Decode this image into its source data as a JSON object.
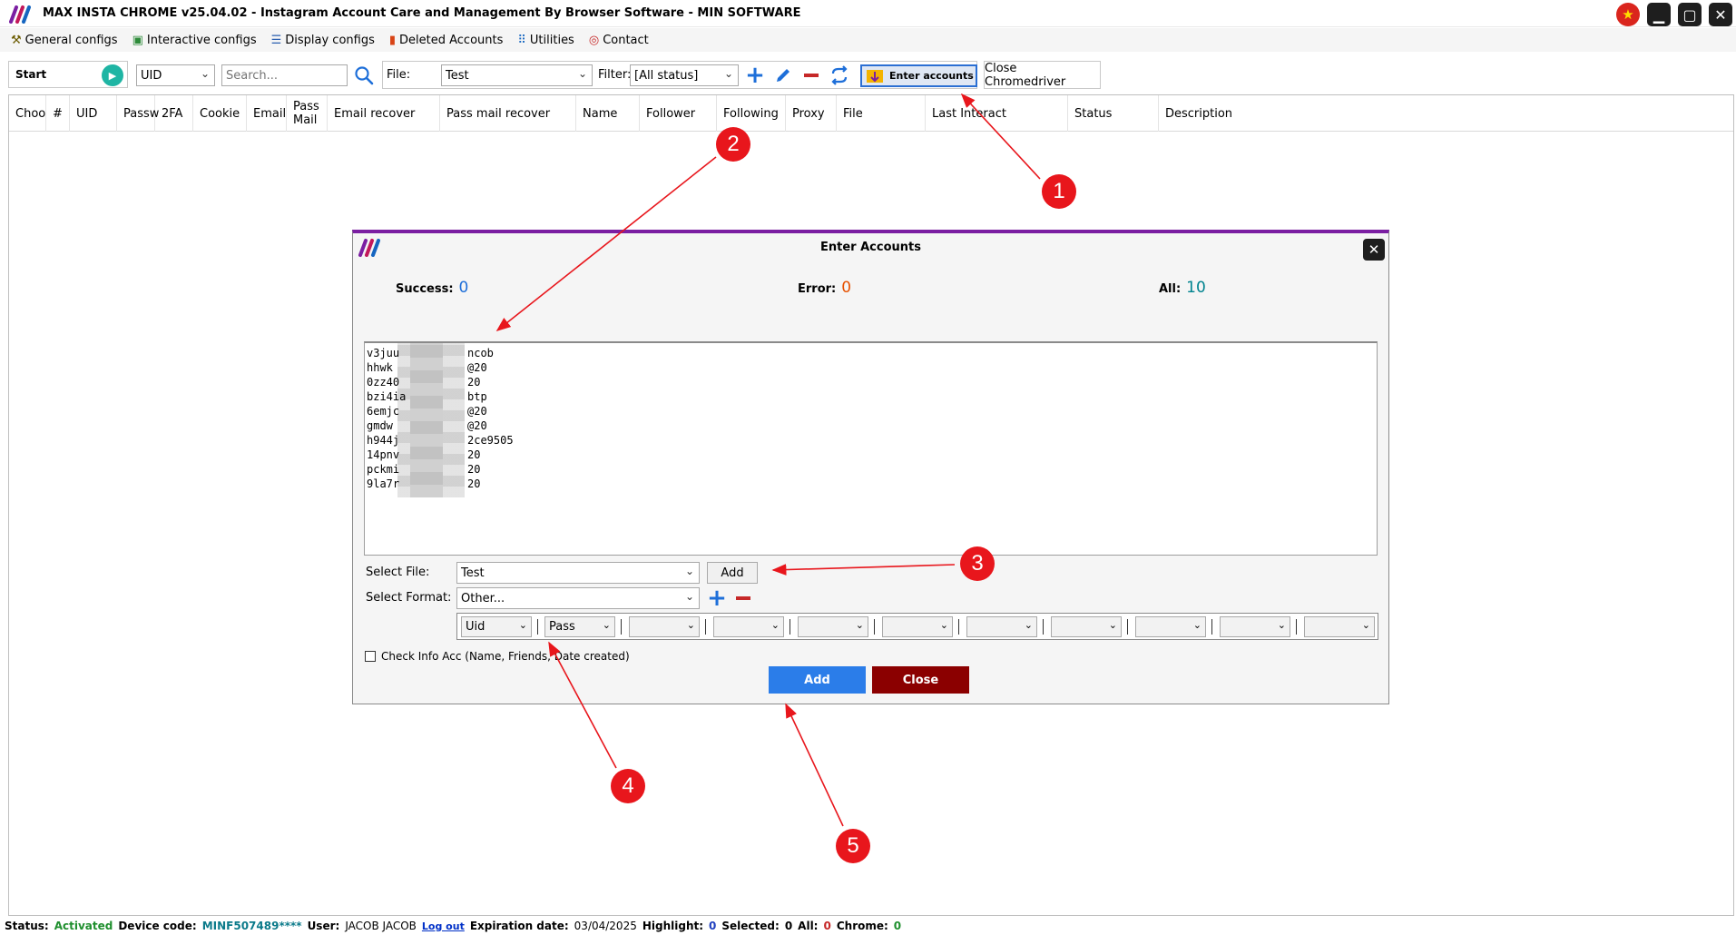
{
  "window": {
    "title": "MAX INSTA CHROME v25.04.02 - Instagram Account Care and Management By Browser Software - MIN SOFTWARE"
  },
  "menu": [
    {
      "label": "General configs",
      "icon": "wrench-icon"
    },
    {
      "label": "Interactive configs",
      "icon": "interactive-icon"
    },
    {
      "label": "Display configs",
      "icon": "list-icon"
    },
    {
      "label": "Deleted Accounts",
      "icon": "trash-icon"
    },
    {
      "label": "Utilities",
      "icon": "grid-icon"
    },
    {
      "label": "Contact",
      "icon": "lifebuoy-icon"
    }
  ],
  "toolbar": {
    "start_label": "Start",
    "search_by": "UID",
    "search_placeholder": "Search...",
    "file_label": "File:",
    "file_value": "Test",
    "filter_label": "Filter:",
    "filter_value": "[All status]",
    "enter_accounts_label": "Enter accounts",
    "close_chromedriver_label": "Close Chromedriver"
  },
  "grid": {
    "columns": [
      "Choo",
      "#",
      "UID",
      "Passw",
      "2FA",
      "Cookie",
      "Email",
      "Pass Mail",
      "Email recover",
      "Pass mail recover",
      "Name",
      "Follower",
      "Following",
      "Proxy",
      "File",
      "Last Interact",
      "Status",
      "Description"
    ]
  },
  "dialog": {
    "title": "Enter Accounts",
    "success_label": "Success:",
    "success_value": "0",
    "error_label": "Error:",
    "error_value": "0",
    "all_label": "All:",
    "all_value": "10",
    "accounts": [
      {
        "start": "v3juu",
        "end": "ncob"
      },
      {
        "start": "hhwk",
        "end": "@20"
      },
      {
        "start": "0zz40",
        "end": "20"
      },
      {
        "start": "bzi4ia",
        "end": "btp"
      },
      {
        "start": "6emjc",
        "end": "@20"
      },
      {
        "start": "gmdw",
        "end": "@20"
      },
      {
        "start": "h944j",
        "end": "2ce9505"
      },
      {
        "start": "14pnv",
        "end": "20"
      },
      {
        "start": "pckmi",
        "end": "20"
      },
      {
        "start": "9la7r",
        "end": "20"
      }
    ],
    "select_file_label": "Select File:",
    "select_file_value": "Test",
    "add_file_label": "Add",
    "select_format_label": "Select Format:",
    "select_format_value": "Other...",
    "format_fields": [
      "Uid",
      "Pass",
      "",
      "",
      "",
      "",
      "",
      "",
      "",
      "",
      ""
    ],
    "check_info_label": "Check Info Acc (Name, Friends, Date created)",
    "add_label": "Add",
    "close_label": "Close"
  },
  "status_bar": {
    "status_label": "Status:",
    "status_value": "Activated",
    "device_label": "Device code:",
    "device_value": "MINF507489****",
    "user_label": "User:",
    "user_value": "JACOB JACOB",
    "logout_label": "Log out",
    "expiration_label": "Expiration date:",
    "expiration_value": "03/04/2025",
    "highlight_label": "Highlight:",
    "highlight_value": "0",
    "selected_label": "Selected:",
    "selected_value": "0",
    "all_label": "All:",
    "all_value": "0",
    "chrome_label": "Chrome:",
    "chrome_value": "0"
  },
  "annotations": [
    "1",
    "2",
    "3",
    "4",
    "5"
  ],
  "colors": {
    "accent_purple": "#7b1fa2",
    "add_blue": "#2b7de9",
    "close_red": "#8b0000",
    "annotation_red": "#e8161c"
  }
}
